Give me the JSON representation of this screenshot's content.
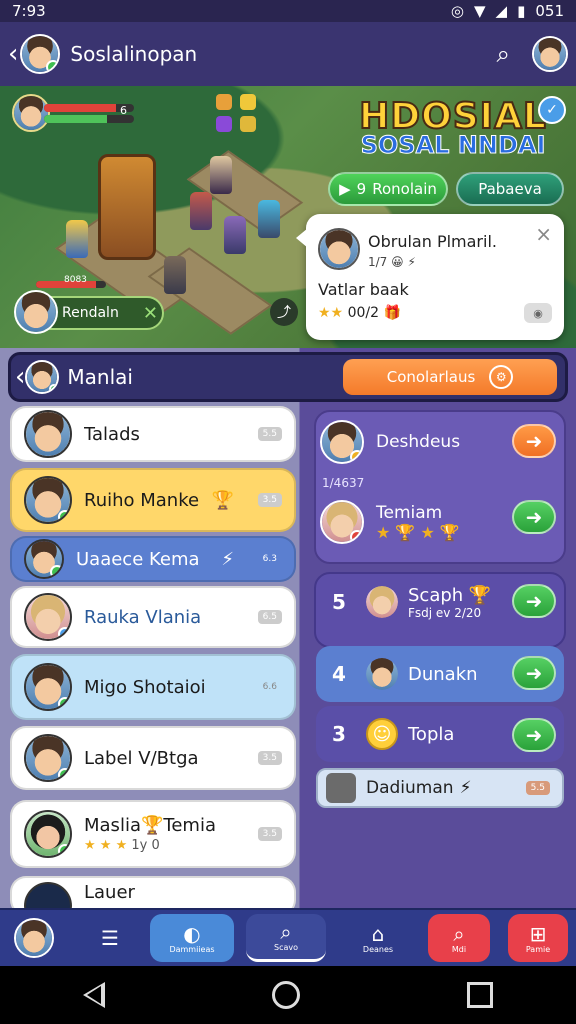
{
  "status_bar": {
    "time": "7:93",
    "battery": "051"
  },
  "app_bar": {
    "title": "Soslalinopan"
  },
  "game": {
    "hud_values": [
      "6",
      "6"
    ],
    "small_bar_value": "8083",
    "logo_line1": "HDOSIAL",
    "logo_line2": "SOSAL NNDAI",
    "btn_primary": "Ronolain",
    "btn_primary_prefix": "9",
    "btn_secondary": "Pabaeva",
    "player_chip_label": "Rendaln",
    "popup": {
      "name": "Obrulan Plmaril.",
      "sub": "1/7",
      "line2": "Vatlar baak",
      "line3": "00/2",
      "close_label": "×"
    }
  },
  "section": {
    "title": "Manlai",
    "action_label": "Conolarlaus"
  },
  "list_items": [
    {
      "label": "Talads",
      "tag": "5.5"
    },
    {
      "label": "Ruiho Manke",
      "tag": "3.5"
    },
    {
      "label": "Uaaece Kema",
      "tag": "6.3"
    },
    {
      "label": "Rauka Vlania",
      "tag": "6.5"
    },
    {
      "label": "Migo Shotaioi",
      "tag": "6.6"
    },
    {
      "label": "Label V/Btga",
      "tag": "3.5"
    },
    {
      "label": "Maslia",
      "label_b": "Temia",
      "sub": "1y 0",
      "tag": "3.5"
    },
    {
      "label": "Lauer",
      "tag": ""
    }
  ],
  "right_items": [
    {
      "label": "Deshdeus",
      "sub": "1/4637"
    },
    {
      "label": "Temiam"
    }
  ],
  "ranks": [
    {
      "rank": "5",
      "label": "Scaph",
      "sub": "Fsdj ev 2/20"
    },
    {
      "rank": "4",
      "label": "Dunakn"
    },
    {
      "rank": "3",
      "label": "Topla"
    }
  ],
  "bottom_pill": {
    "label": "Dadiuman",
    "tag": "5.5"
  },
  "bottom_nav": [
    {
      "label": ""
    },
    {
      "label": ""
    },
    {
      "label": "Dammiieas"
    },
    {
      "label": "Scavo"
    },
    {
      "label": "Deanes"
    },
    {
      "label": "Mdi"
    },
    {
      "label": "Pamie"
    }
  ],
  "colors": {
    "accent_orange": "#f47a2a",
    "accent_green": "#2aa23a",
    "nav_bg": "#2f3b8a",
    "panel_purple": "#5a4c9a"
  }
}
